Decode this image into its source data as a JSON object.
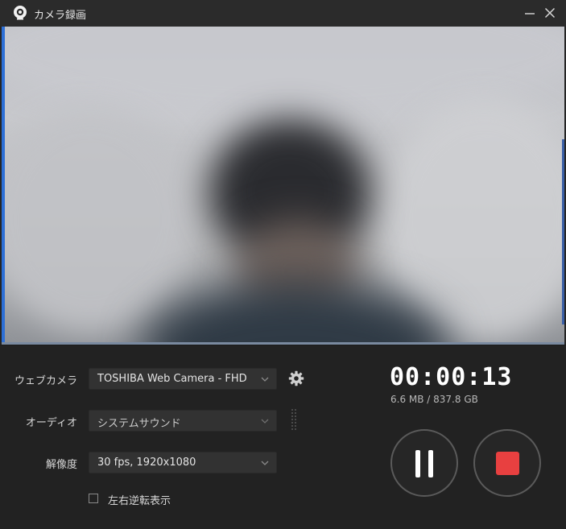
{
  "window": {
    "title": "カメラ録画",
    "icon": "webcam-app-icon",
    "minimize_icon": "minimize-icon",
    "close_icon": "close-icon"
  },
  "preview": {
    "description_icon": "camera-preview"
  },
  "settings": {
    "webcam": {
      "label": "ウェブカメラ",
      "value": "TOSHIBA Web Camera - FHD"
    },
    "audio": {
      "label": "オーディオ",
      "value": "システムサウンド"
    },
    "resolution": {
      "label": "解像度",
      "value": "30 fps, 1920x1080"
    },
    "mirror": {
      "label": "左右逆転表示",
      "checked": false
    }
  },
  "recording": {
    "elapsed": "00:00:13",
    "storage": "6.6 MB / 837.8 GB"
  },
  "colors": {
    "accent_stop": "#e84040",
    "background": "#222222",
    "titlebar": "#2b2b2b"
  }
}
